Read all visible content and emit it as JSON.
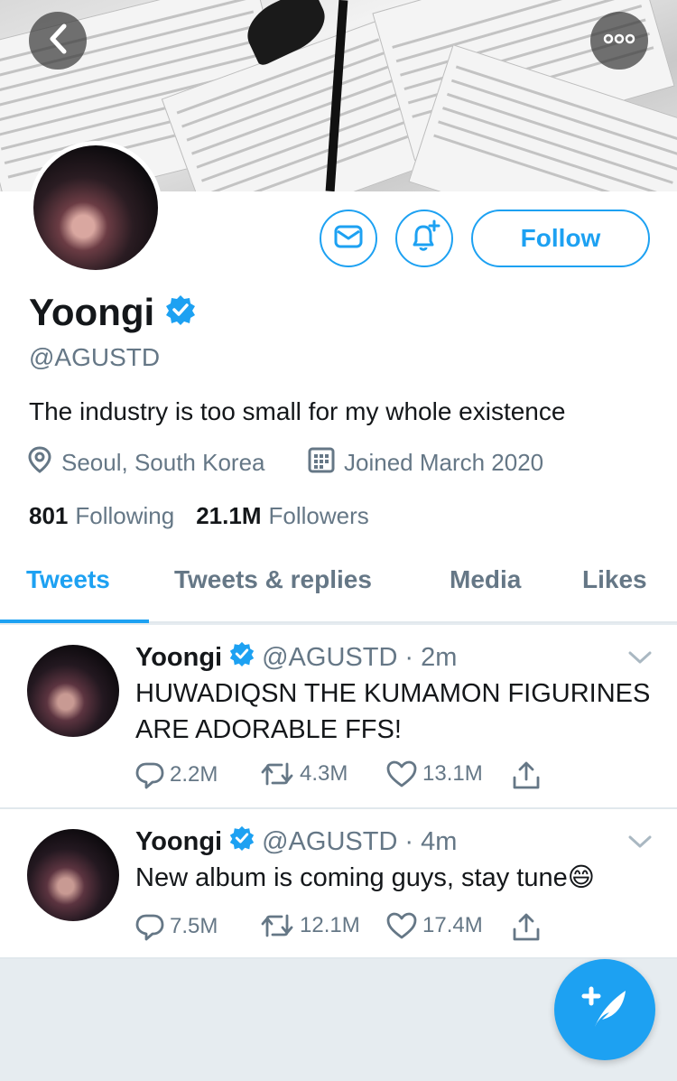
{
  "profile": {
    "name": "Yoongi",
    "handle": "@AGUSTD",
    "bio": "The industry is too small for my whole existence",
    "location": "Seoul, South Korea",
    "joined": "Joined March 2020",
    "following_count": "801",
    "following_label": "Following",
    "followers_count": "21.1M",
    "followers_label": "Followers",
    "follow_label": "Follow"
  },
  "tabs": [
    {
      "label": "Tweets",
      "active": true
    },
    {
      "label": "Tweets & replies",
      "active": false
    },
    {
      "label": "Media",
      "active": false
    },
    {
      "label": "Likes",
      "active": false
    }
  ],
  "tweets": [
    {
      "name": "Yoongi",
      "handle": "@AGUSTD",
      "time": "· 2m",
      "text": "HUWADIQSN THE KUMAMON FIGURINES ARE ADORABLE FFS!",
      "replies": "2.2M",
      "retweets": "4.3M",
      "likes": "13.1M"
    },
    {
      "name": "Yoongi",
      "handle": "@AGUSTD",
      "time": "· 4m",
      "text": "New album is coming guys, stay tune",
      "emoji": "😄",
      "replies": "7.5M",
      "retweets": "12.1M",
      "likes": "17.4M"
    }
  ],
  "icons": {
    "back": "back-arrow-icon",
    "more": "more-icon",
    "message": "envelope-icon",
    "notify": "bell-plus-icon",
    "verified": "verified-badge-icon",
    "location": "location-pin-icon",
    "calendar": "calendar-icon",
    "reply": "reply-icon",
    "retweet": "retweet-icon",
    "like": "heart-icon",
    "share": "share-icon",
    "compose": "compose-tweet-icon",
    "chevron": "chevron-down-icon"
  },
  "colors": {
    "accent": "#1da1f2",
    "text": "#14171a",
    "muted": "#657786",
    "background": "#e6ecf0"
  }
}
